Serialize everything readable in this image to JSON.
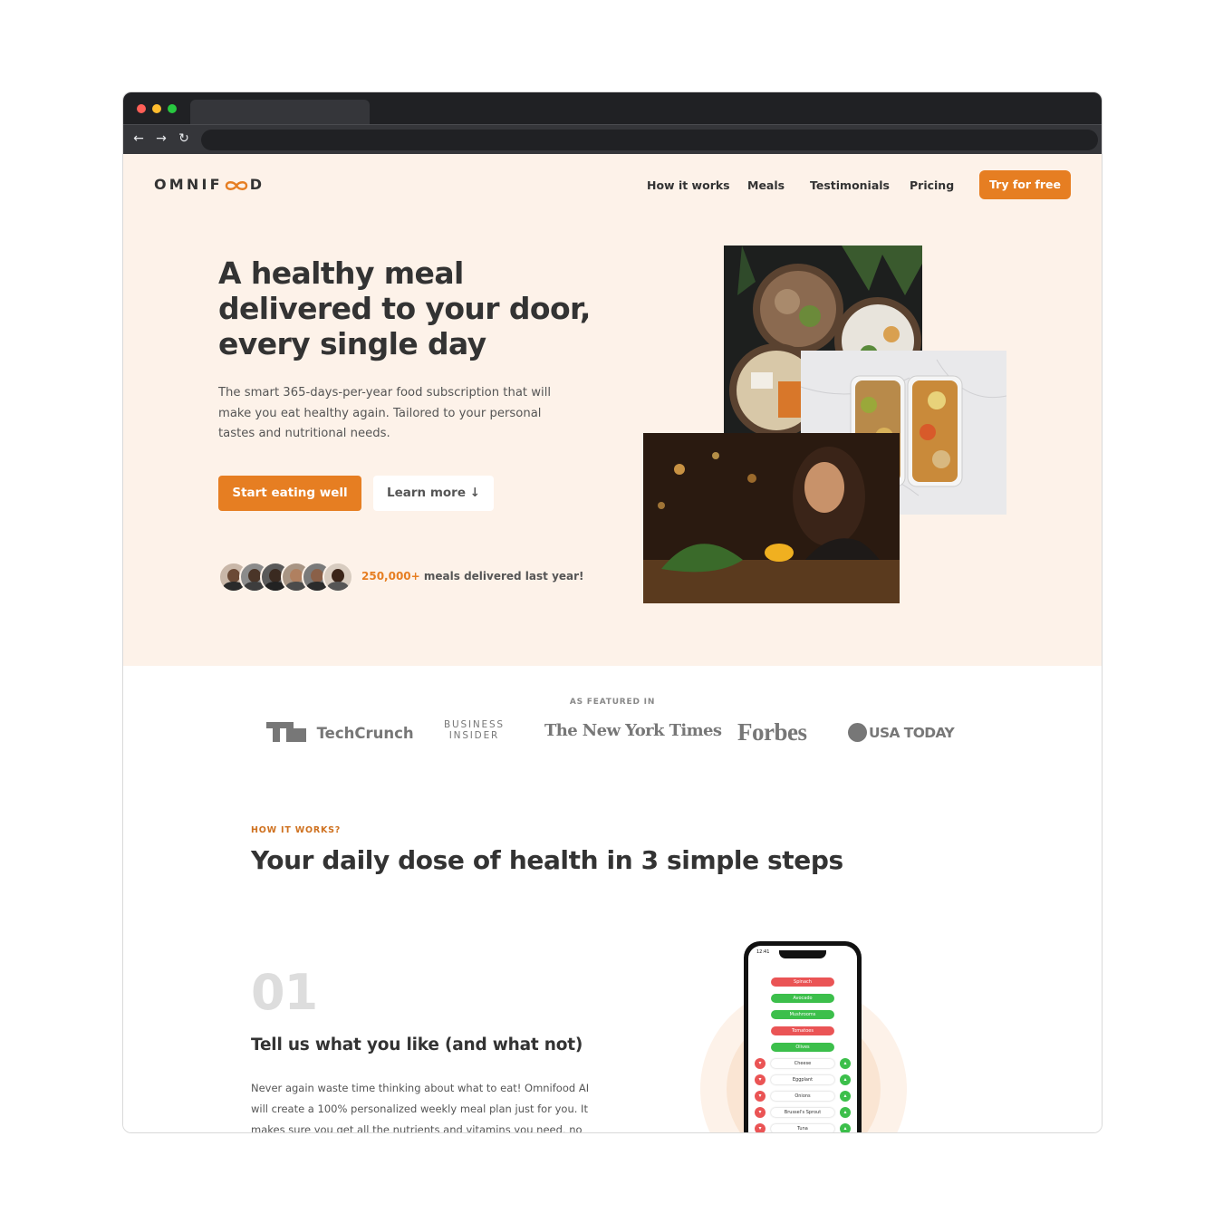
{
  "colors": {
    "accent": "#e67e22",
    "hero_bg": "#fdf2e9",
    "text_dark": "#333333",
    "text_body": "#555555",
    "tag": "#cf711f"
  },
  "browser": {
    "icons": [
      "back-arrow-icon",
      "forward-arrow-icon",
      "reload-icon"
    ]
  },
  "header": {
    "logo_text_left": "OMNIF",
    "logo_text_right": "D",
    "nav": [
      "How it works",
      "Meals",
      "Testimonials",
      "Pricing"
    ],
    "cta": "Try for free"
  },
  "hero": {
    "title": "A healthy meal delivered to your door, every single day",
    "description": "The smart 365-days-per-year food subscription that will make you eat healthy again. Tailored to your personal tastes and nutritional needs.",
    "primary_button": "Start eating well",
    "secondary_button": "Learn more ↓",
    "delivered_highlight": "250,000+",
    "delivered_text": " meals delivered last year!"
  },
  "featured": {
    "label": "AS FEATURED IN",
    "logos": [
      "TechCrunch",
      "BUSINESS",
      "INSIDER",
      "The New York Times",
      "Forbes",
      "USA TODAY"
    ]
  },
  "how_it_works": {
    "tag": "HOW IT WORKS?",
    "title": "Your daily dose of health in 3 simple steps",
    "step_number": "01",
    "step_title": "Tell us what you like (and what not)",
    "step_text": "Never again waste time thinking about what to eat! Omnifood AI will create a 100% personalized weekly meal plan just for you. It makes sure you get all the nutrients and vitamins you need, no"
  },
  "phone": {
    "time": "12:41",
    "pills": [
      {
        "label": "Spinach",
        "color": "red"
      },
      {
        "label": "Avocado",
        "color": "green"
      },
      {
        "label": "Mushrooms",
        "color": "green"
      },
      {
        "label": "Tomatoes",
        "color": "red"
      },
      {
        "label": "Olives",
        "color": "green"
      }
    ],
    "rows": [
      "Cheese",
      "Eggplant",
      "Onions",
      "Brussel's Sprout",
      "Tuna"
    ]
  }
}
